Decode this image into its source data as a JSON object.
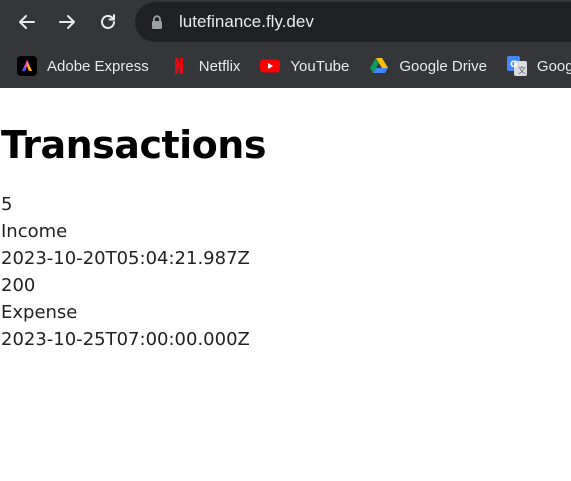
{
  "browser": {
    "url": "lutefinance.fly.dev",
    "bookmarks": [
      {
        "label": "Adobe Express",
        "icon": "adobe-express-icon"
      },
      {
        "label": "Netflix",
        "icon": "netflix-icon"
      },
      {
        "label": "YouTube",
        "icon": "youtube-icon"
      },
      {
        "label": "Google Drive",
        "icon": "google-drive-icon"
      },
      {
        "label": "Goog",
        "icon": "google-translate-icon"
      }
    ]
  },
  "page": {
    "title": "Transactions",
    "transactions": [
      {
        "amount": "5",
        "type": "Income",
        "date": "2023-10-20T05:04:21.987Z"
      },
      {
        "amount": "200",
        "type": "Expense",
        "date": "2023-10-25T07:00:00.000Z"
      }
    ]
  },
  "colors": {
    "chrome_bg": "#35363a",
    "omnibox_bg": "#202124",
    "chrome_text": "#e8eaed"
  }
}
